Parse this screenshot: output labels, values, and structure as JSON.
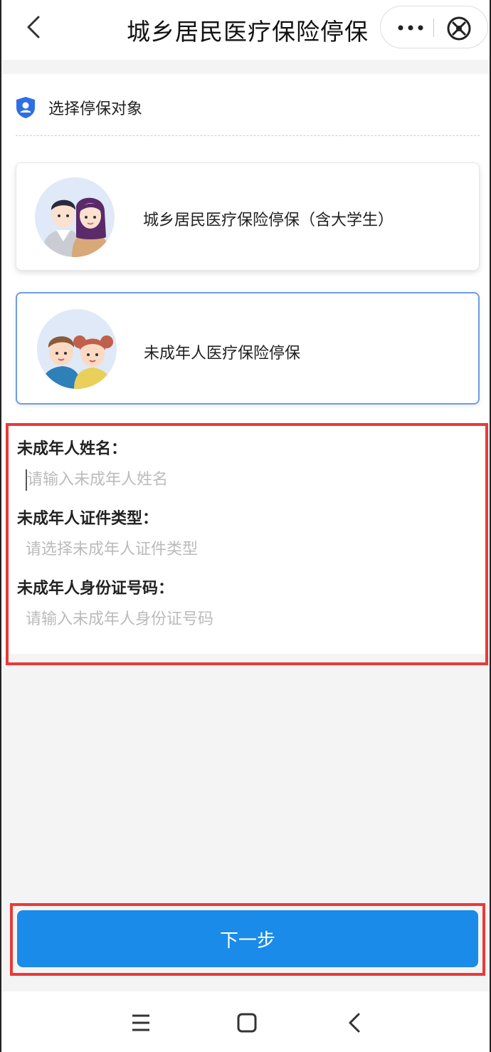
{
  "header": {
    "title": "城乡居民医疗保险停保",
    "back_icon": "chevron-left-icon",
    "more_icon": "more-dots-icon",
    "close_icon": "close-circle-icon"
  },
  "section": {
    "title": "选择停保对象",
    "icon": "shield-user-icon"
  },
  "options": [
    {
      "label": "城乡居民医疗保险停保（含大学生）",
      "avatar": "adult-couple-avatar",
      "selected": false
    },
    {
      "label": "未成年人医疗保险停保",
      "avatar": "children-avatar",
      "selected": true
    }
  ],
  "form": {
    "name_label": "未成年人姓名：",
    "name_placeholder": "请输入未成年人姓名",
    "idtype_label": "未成年人证件类型：",
    "idtype_placeholder": "请选择未成年人证件类型",
    "idnum_label": "未成年人身份证号码：",
    "idnum_placeholder": "请输入未成年人身份证号码"
  },
  "next_button": "下一步",
  "navbar": {
    "menu_icon": "menu-icon",
    "home_icon": "home-square-icon",
    "back_icon": "back-arrow-icon"
  },
  "colors": {
    "accent": "#1a8be8",
    "selected_border": "#6e9ce6",
    "highlight_red": "#e83a3a",
    "shield": "#2f6fe4"
  }
}
